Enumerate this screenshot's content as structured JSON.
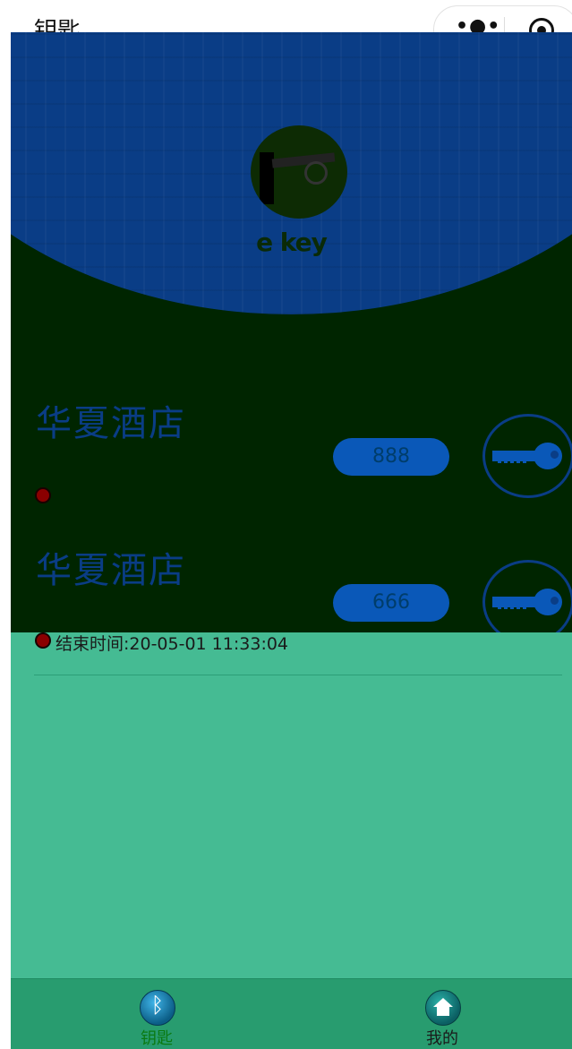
{
  "nav": {
    "title": "钥匙"
  },
  "header": {
    "brand": "e key"
  },
  "keys": [
    {
      "hotel": "华夏酒店",
      "room": "888",
      "end_time": ""
    },
    {
      "hotel": "华夏酒店",
      "room": "666",
      "end_time": "结束时间:20-05-01 11:33:04"
    }
  ],
  "tabbar": {
    "items": [
      {
        "label": "钥匙",
        "icon": "bluetooth-icon",
        "active": true
      },
      {
        "label": "我的",
        "icon": "home-icon",
        "active": false
      }
    ]
  },
  "colors": {
    "content_bg": "#45bb93",
    "overlay": "#002500",
    "banner": "#0a3d86",
    "tabbar": "#289c6f",
    "tab_active": "#0a7a12",
    "tab_inactive": "#1a1a1a"
  }
}
